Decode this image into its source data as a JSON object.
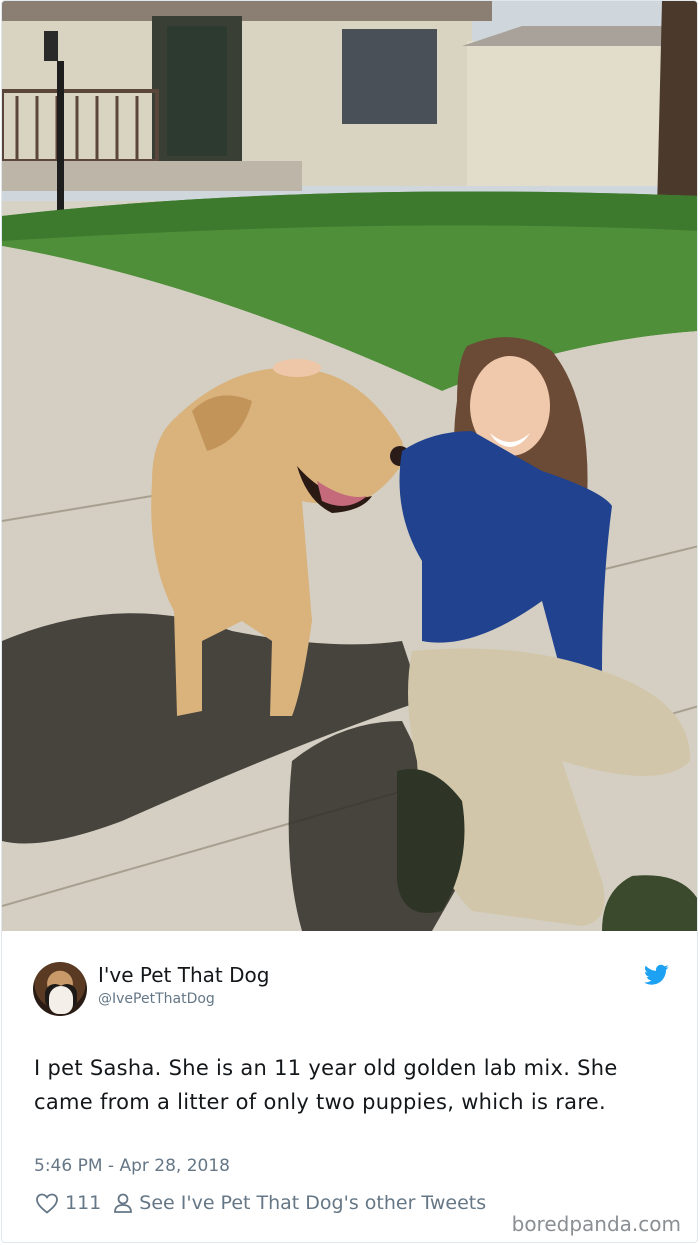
{
  "tweet": {
    "display_name": "I've Pet That Dog",
    "handle": "@IvePetThatDog",
    "text": "I pet Sasha. She is an 11 year old golden lab mix. She came from a litter of only two puppies, which is rare.",
    "timestamp": "5:46 PM - Apr 28, 2018",
    "like_count": "111",
    "other_tweets_label": "See I've Pet That Dog's other Tweets"
  },
  "watermark": "boredpanda.com",
  "icons": {
    "like": "heart-icon",
    "profile": "person-icon",
    "brand": "twitter-bird-icon"
  },
  "colors": {
    "twitter_blue": "#1da1f2",
    "secondary_text": "#657786",
    "primary_text": "#14171a"
  }
}
